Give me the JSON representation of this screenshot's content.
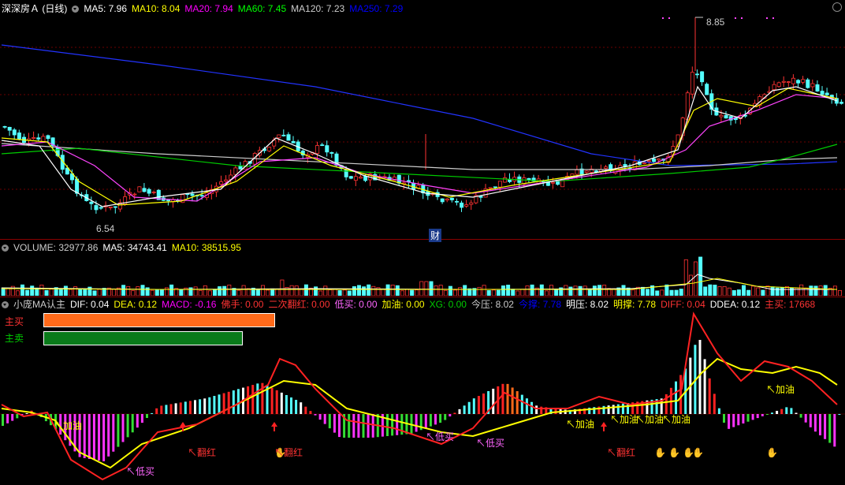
{
  "main": {
    "title": "深深房Ａ (日线)",
    "ma": [
      {
        "label": "MA5: 7.96",
        "color": "#ffffff"
      },
      {
        "label": "MA10: 8.04",
        "color": "#ffff00"
      },
      {
        "label": "MA20: 7.94",
        "color": "#ff00ff"
      },
      {
        "label": "MA60: 7.45",
        "color": "#00ff00"
      },
      {
        "label": "MA120: 7.23",
        "color": "#cccccc"
      },
      {
        "label": "MA250: 7.29",
        "color": "#0000ff"
      }
    ],
    "high_label": "8.85",
    "low_label": "6.54",
    "fin_label": "财"
  },
  "volume": {
    "items": [
      {
        "label": "VOLUME: 32977.86",
        "color": "#cccccc"
      },
      {
        "label": "MA5: 34743.41",
        "color": "#ffffff"
      },
      {
        "label": "MA10: 38515.95",
        "color": "#ffff00"
      }
    ]
  },
  "indicator": {
    "items": [
      {
        "label": "小庞MA认主",
        "color": "#cccccc"
      },
      {
        "label": "DIF: 0.04",
        "color": "#ffffff"
      },
      {
        "label": "DEA: 0.12",
        "color": "#ffff00"
      },
      {
        "label": "MACD: -0.16",
        "color": "#ff00ff"
      },
      {
        "label": "佛手: 0.00",
        "color": "#ff3333"
      },
      {
        "label": "二次翻红: 0.00",
        "color": "#ff3333"
      },
      {
        "label": "低买: 0.00",
        "color": "#ff66ff"
      },
      {
        "label": "加油: 0.00",
        "color": "#ffff00"
      },
      {
        "label": "XG: 0.00",
        "color": "#00cc00"
      },
      {
        "label": "今压: 8.02",
        "color": "#cccccc"
      },
      {
        "label": "今撑: 7.78",
        "color": "#0000ff"
      },
      {
        "label": "明压: 8.02",
        "color": "#ffffff"
      },
      {
        "label": "明撑: 7.78",
        "color": "#ffff00"
      },
      {
        "label": "DIFF: 0.04",
        "color": "#ff3333"
      },
      {
        "label": "DDEA: 0.12",
        "color": "#ffffff"
      },
      {
        "label": "主买: 17668",
        "color": "#ff3333"
      }
    ],
    "buy_label": "主买",
    "sell_label": "主卖",
    "buy_ratio": 1.0,
    "sell_ratio": 0.86,
    "annotations": [
      {
        "text": "加油",
        "color": "#ffff00"
      },
      {
        "text": "低买",
        "color": "#ff66ff"
      },
      {
        "text": "翻红",
        "color": "#ff3333"
      },
      {
        "text": "翻红",
        "color": "#ff3333"
      },
      {
        "text": "低买",
        "color": "#ff66ff"
      },
      {
        "text": "低买",
        "color": "#ff66ff"
      },
      {
        "text": "加油",
        "color": "#ffff00"
      },
      {
        "text": "翻红",
        "color": "#ff3333"
      },
      {
        "text": "加油",
        "color": "#ffff00"
      },
      {
        "text": "加油",
        "color": "#ffff00"
      },
      {
        "text": "加油",
        "color": "#ffff00"
      },
      {
        "text": "加油",
        "color": "#ffff00"
      }
    ]
  }
}
